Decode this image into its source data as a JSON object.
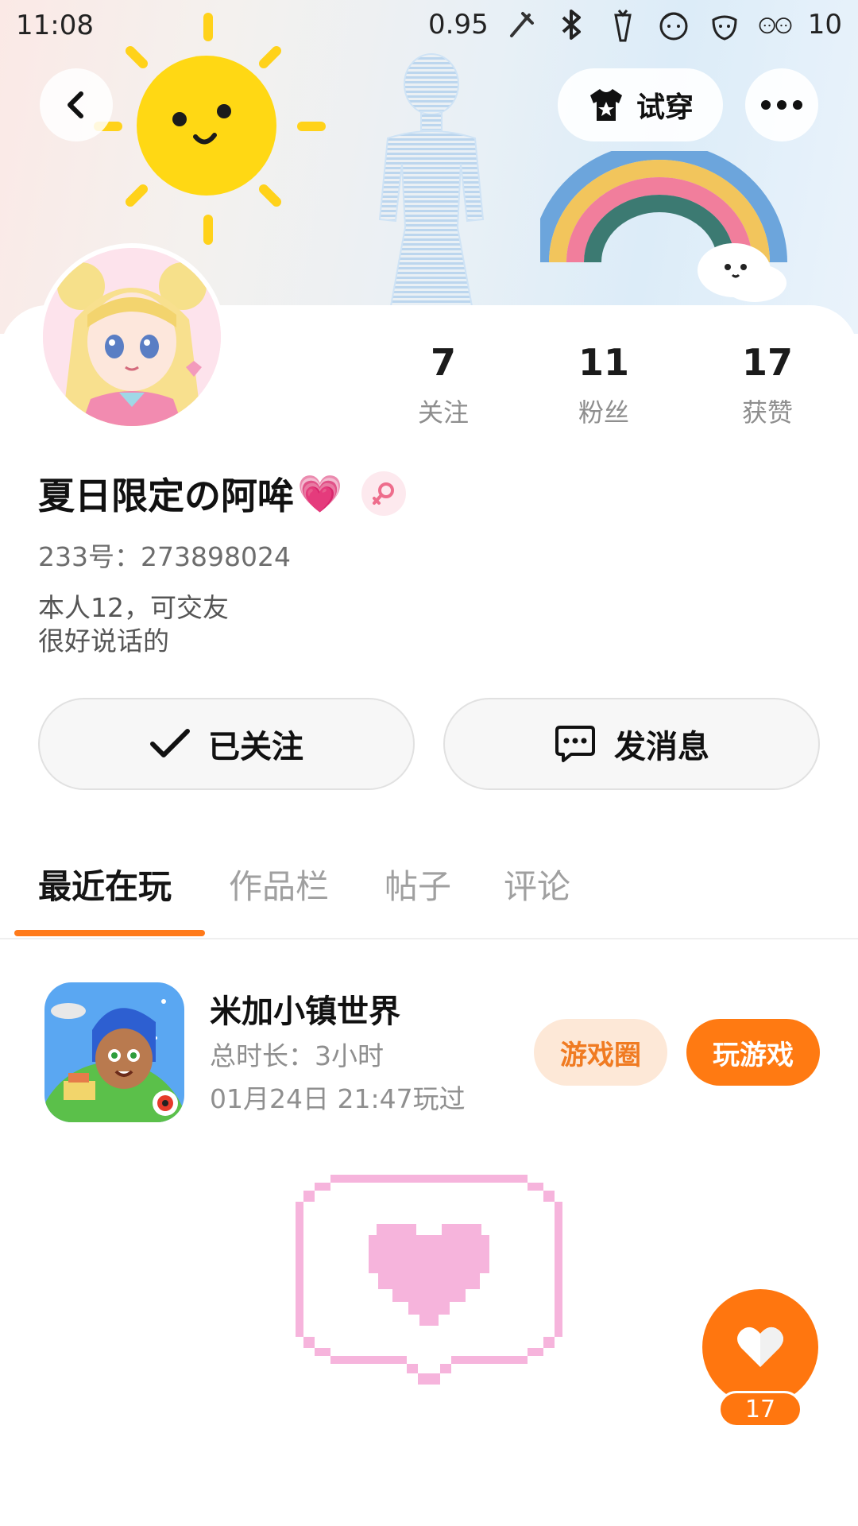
{
  "status_bar": {
    "time": "11:08",
    "speed": "0.95",
    "battery": "10",
    "icons": [
      "sticker-icon",
      "bluetooth-icon",
      "carrot-icon",
      "girl-face-icon",
      "strawberry-icon",
      "kids-face-icon"
    ]
  },
  "header": {
    "back_icon": "chevron-left-icon",
    "try_on_label": "试穿",
    "try_on_icon": "shirt-star-icon",
    "more_icon": "more-horizontal-icon"
  },
  "profile": {
    "name": "夏日限定の阿哞",
    "name_emoji": "💗",
    "gender_icon": "female-icon",
    "uid_label": "233号：",
    "uid": "273898024",
    "bio_line1": "本人12，可交友",
    "bio_line2": "很好说话的"
  },
  "stats": [
    {
      "value": "7",
      "label": "关注"
    },
    {
      "value": "11",
      "label": "粉丝"
    },
    {
      "value": "17",
      "label": "获赞"
    }
  ],
  "actions": {
    "follow_label": "已关注",
    "message_label": "发消息"
  },
  "tabs": [
    {
      "label": "最近在玩",
      "active": true
    },
    {
      "label": "作品栏",
      "active": false
    },
    {
      "label": "帖子",
      "active": false
    },
    {
      "label": "评论",
      "active": false
    }
  ],
  "recent_game": {
    "title": "米加小镇世界",
    "duration": "总时长：3小时",
    "last_played": "01月24日 21:47玩过",
    "circle_button": "游戏圈",
    "play_button": "玩游戏"
  },
  "like_fab": {
    "count": "17"
  },
  "colors": {
    "accent": "#ff7a12",
    "accent_light": "#fde8d7",
    "tab_indicator": "#ff7a1a",
    "pixel_heart": "#f6b4dc"
  }
}
